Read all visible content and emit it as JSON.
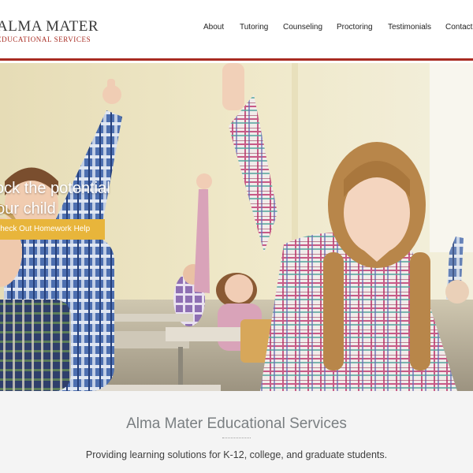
{
  "header": {
    "logo_line1": "ALMA MATER",
    "logo_line2": "EDUCATIONAL SERVICES",
    "nav": [
      {
        "label": "About"
      },
      {
        "label": "Tutoring"
      },
      {
        "label": "Counseling"
      },
      {
        "label": "Proctoring"
      },
      {
        "label": "Testimonials"
      },
      {
        "label": "Contact"
      }
    ]
  },
  "hero": {
    "headline_line1": "Unlock the potential",
    "headline_line2": "in your child",
    "cta_label": "Check Out Homework Help"
  },
  "intro": {
    "title": "Alma Mater Educational Services",
    "subtitle": "Providing learning solutions for K-12, college, and graduate students."
  },
  "colors": {
    "brand_red": "#a82b22",
    "cta_yellow": "#e8b53b",
    "intro_bg": "#f4f4f4"
  }
}
